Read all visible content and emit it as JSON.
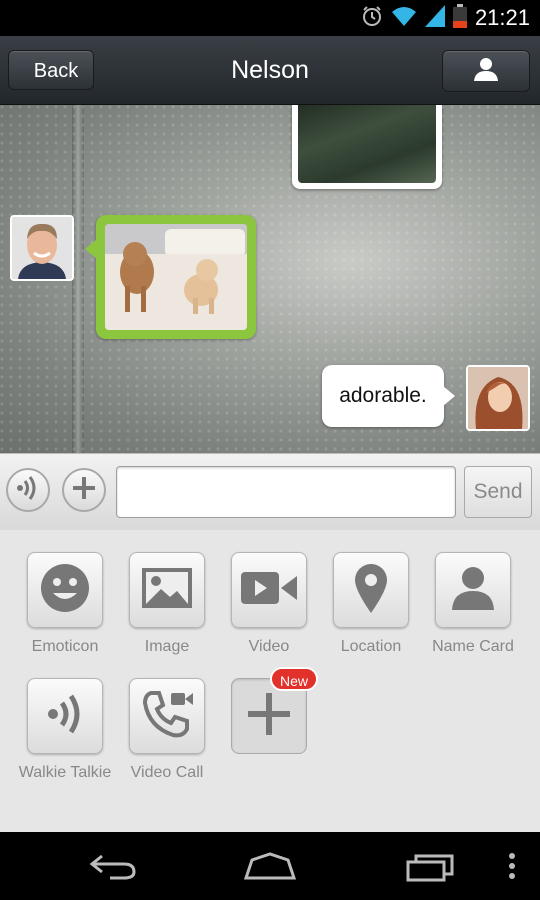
{
  "status_bar": {
    "time": "21:21",
    "icons": [
      "alarm-icon",
      "wifi-icon",
      "signal-icon",
      "battery-icon"
    ]
  },
  "header": {
    "back_label": "Back",
    "title": "Nelson",
    "profile_icon": "contact-icon"
  },
  "chat": {
    "messages": [
      {
        "from": "me",
        "type": "image"
      },
      {
        "from": "Nelson",
        "type": "image"
      },
      {
        "from": "me",
        "type": "text",
        "text": "adorable."
      }
    ]
  },
  "input_bar": {
    "input_value": "",
    "send_label": "Send"
  },
  "panel": {
    "items": [
      {
        "label": "Emoticon",
        "icon": "emoticon-icon"
      },
      {
        "label": "Image",
        "icon": "image-icon"
      },
      {
        "label": "Video",
        "icon": "video-camera-icon"
      },
      {
        "label": "Location",
        "icon": "location-pin-icon"
      },
      {
        "label": "Name Card",
        "icon": "name-card-icon"
      },
      {
        "label": "Walkie Talkie",
        "icon": "walkie-talkie-icon"
      },
      {
        "label": "Video Call",
        "icon": "video-call-icon"
      },
      {
        "label": "",
        "icon": "plus-icon",
        "badge": "New"
      }
    ]
  },
  "colors": {
    "accent_green": "#8cc63f",
    "badge_red": "#e2302a",
    "status_blue": "#33b5e5"
  },
  "nav_bar": {
    "buttons": [
      "back-nav-icon",
      "home-nav-icon",
      "recents-nav-icon",
      "menu-nav-icon"
    ]
  }
}
